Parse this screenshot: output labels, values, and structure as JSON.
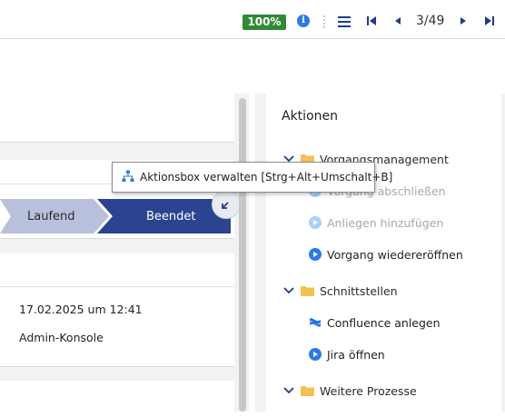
{
  "toolbar": {
    "zoom": "100%",
    "info_icon": "info-icon",
    "menu_icon": "hamburger-icon",
    "page_indicator": "3/49"
  },
  "process": {
    "steps": [
      {
        "label": "Laufend",
        "color": "#b8c0dc",
        "active": false
      },
      {
        "label": "Beendet",
        "color": "#2a4490",
        "active": true
      }
    ]
  },
  "details": {
    "date": "17.02.2025 um 12:41",
    "user": "Admin-Konsole"
  },
  "tooltip": {
    "text": "Aktionsbox verwalten [Strg+Alt+Umschalt+B]"
  },
  "actions": {
    "title": "Aktionen",
    "groups": [
      {
        "label": "Vorgangsmanagement",
        "items": [
          {
            "label": "Vorgang abschließen",
            "enabled": false,
            "icon": "play-icon"
          },
          {
            "label": "Anliegen hinzufügen",
            "enabled": false,
            "icon": "play-icon"
          },
          {
            "label": "Vorgang wiedereröffnen",
            "enabled": true,
            "icon": "play-icon"
          }
        ]
      },
      {
        "label": "Schnittstellen",
        "items": [
          {
            "label": "Confluence anlegen",
            "enabled": true,
            "icon": "confluence-icon"
          },
          {
            "label": "Jira öffnen",
            "enabled": true,
            "icon": "play-icon"
          }
        ]
      },
      {
        "label": "Weitere Prozesse",
        "items": []
      }
    ]
  },
  "colors": {
    "accent": "#1f3a8a",
    "success": "#2f8a35",
    "play_enabled": "#2c7be5",
    "play_disabled": "#a9d0f5",
    "folder": "#f4c04f"
  }
}
